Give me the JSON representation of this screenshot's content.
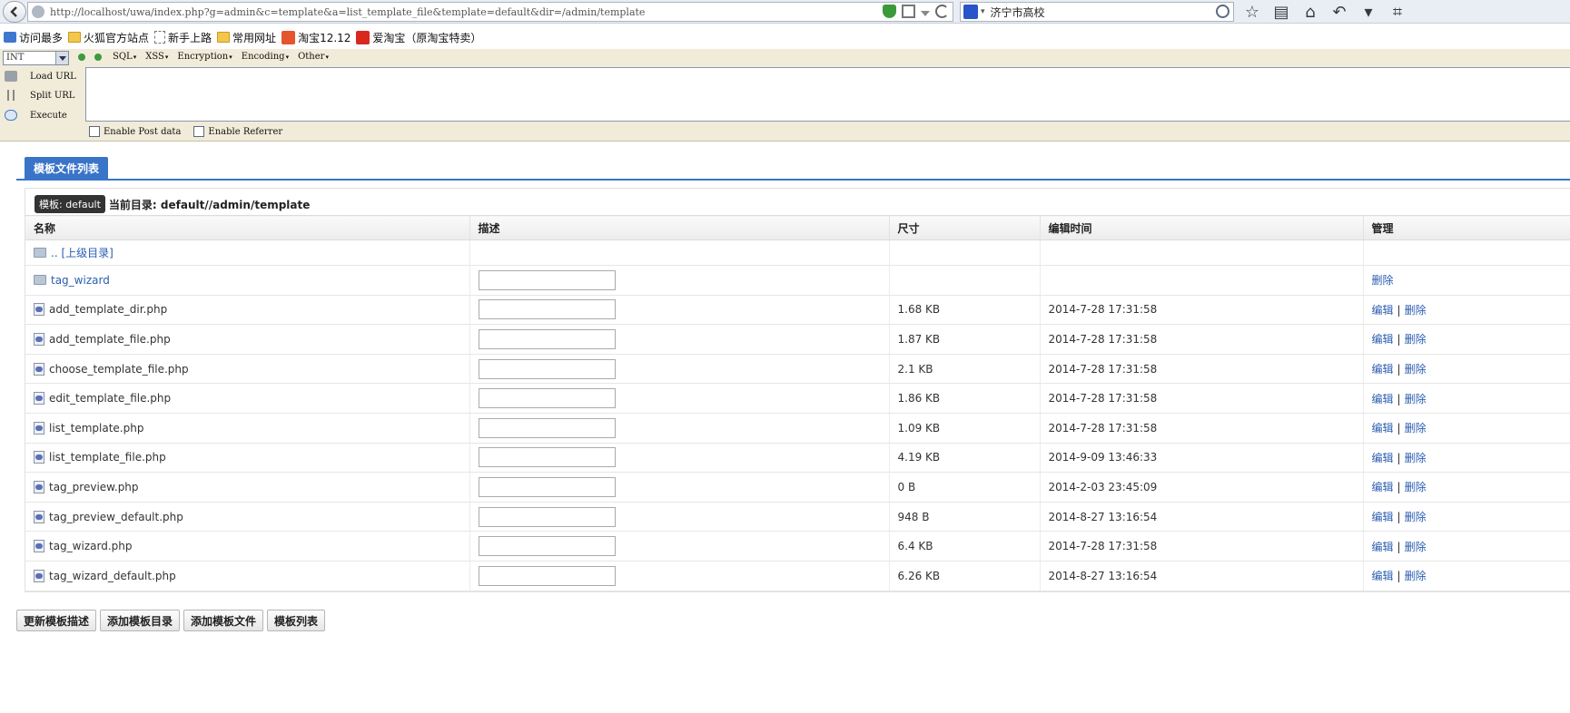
{
  "browser": {
    "url": "http://localhost/uwa/index.php?g=admin&c=template&a=list_template_file&template=default&dir=/admin/template",
    "search_text": "济宁市高校"
  },
  "bookmarks": [
    {
      "label": "访问最多",
      "icon": "search-bookmark-icon"
    },
    {
      "label": "火狐官方站点",
      "icon": "folder-icon"
    },
    {
      "label": "新手上路",
      "icon": "page-icon"
    },
    {
      "label": "常用网址",
      "icon": "folder-icon"
    },
    {
      "label": "淘宝12.12",
      "icon": "taobao-icon"
    },
    {
      "label": "爱淘宝（原淘宝特卖）",
      "icon": "taobao-icon"
    }
  ],
  "hackbar": {
    "select_value": "INT",
    "menus": [
      "SQL",
      "XSS",
      "Encryption",
      "Encoding",
      "Other"
    ],
    "actions": [
      "Load URL",
      "Split URL",
      "Execute"
    ],
    "checks": [
      "Enable Post data",
      "Enable Referrer"
    ]
  },
  "page": {
    "tab_label": "模板文件列表",
    "template_badge": "模板: default",
    "current_dir": "当前目录: default//admin/template",
    "columns": [
      "名称",
      "描述",
      "尺寸",
      "编辑时间",
      "管理"
    ],
    "up_dir": ".. [上级目录]",
    "edit_label": "编辑",
    "delete_label": "删除",
    "sep": "|",
    "rows": [
      {
        "name": "tag_wizard",
        "size": "",
        "time": "",
        "type": "folder"
      },
      {
        "name": "add_template_dir.php",
        "size": "1.68 KB",
        "time": "2014-7-28 17:31:58",
        "type": "file"
      },
      {
        "name": "add_template_file.php",
        "size": "1.87 KB",
        "time": "2014-7-28 17:31:58",
        "type": "file"
      },
      {
        "name": "choose_template_file.php",
        "size": "2.1 KB",
        "time": "2014-7-28 17:31:58",
        "type": "file"
      },
      {
        "name": "edit_template_file.php",
        "size": "1.86 KB",
        "time": "2014-7-28 17:31:58",
        "type": "file"
      },
      {
        "name": "list_template.php",
        "size": "1.09 KB",
        "time": "2014-7-28 17:31:58",
        "type": "file"
      },
      {
        "name": "list_template_file.php",
        "size": "4.19 KB",
        "time": "2014-9-09 13:46:33",
        "type": "file"
      },
      {
        "name": "tag_preview.php",
        "size": "0 B",
        "time": "2014-2-03 23:45:09",
        "type": "file"
      },
      {
        "name": "tag_preview_default.php",
        "size": "948 B",
        "time": "2014-8-27 13:16:54",
        "type": "file"
      },
      {
        "name": "tag_wizard.php",
        "size": "6.4 KB",
        "time": "2014-7-28 17:31:58",
        "type": "file"
      },
      {
        "name": "tag_wizard_default.php",
        "size": "6.26 KB",
        "time": "2014-8-27 13:16:54",
        "type": "file"
      }
    ],
    "buttons": [
      "更新模板描述",
      "添加模板目录",
      "添加模板文件",
      "模板列表"
    ]
  }
}
